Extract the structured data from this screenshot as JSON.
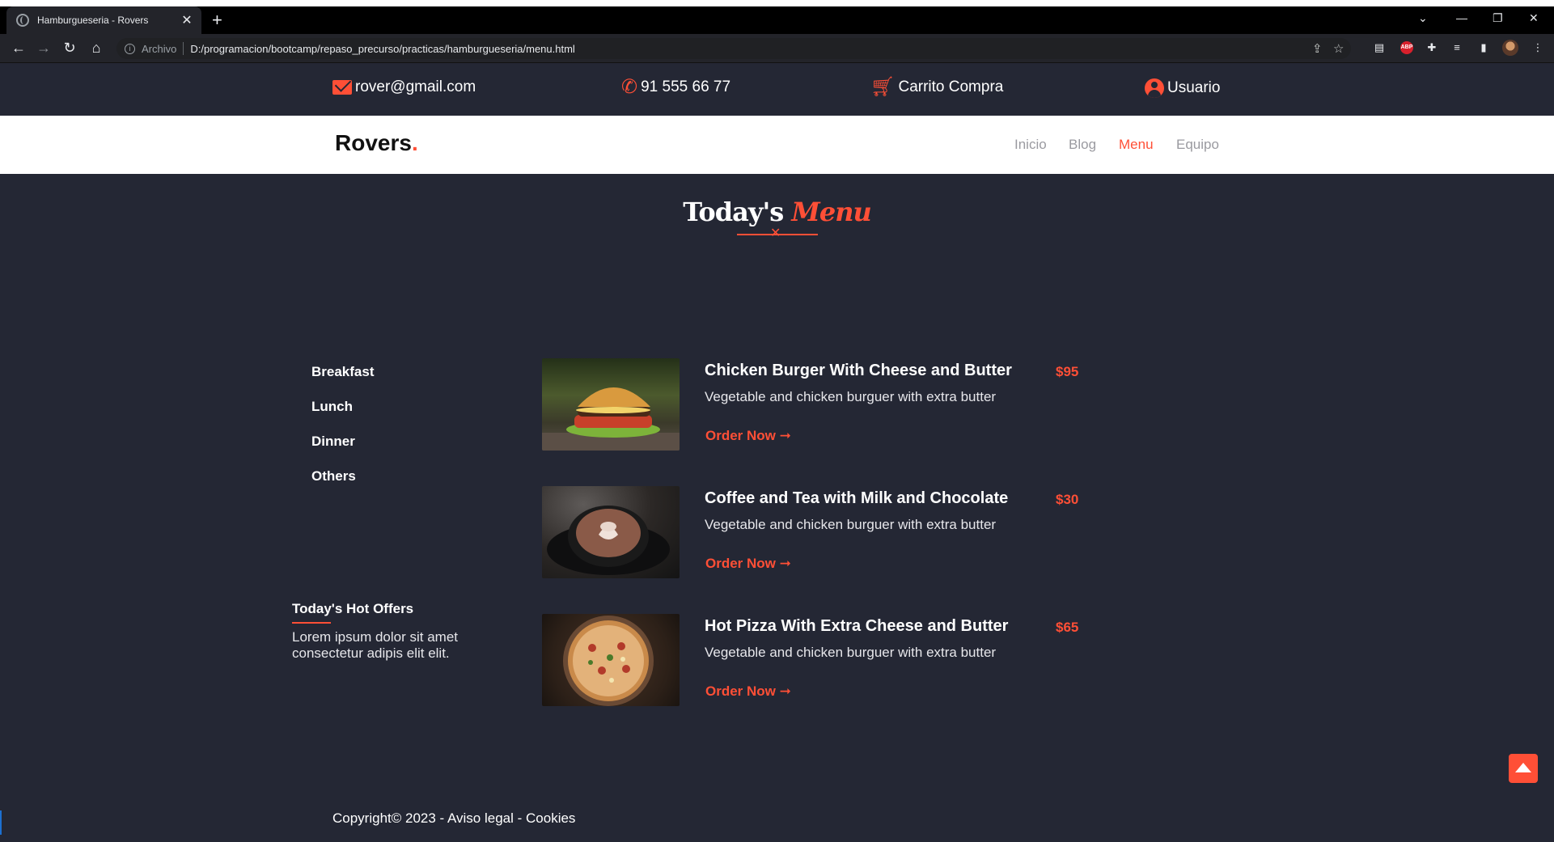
{
  "browser": {
    "tab_title": "Hamburgueseria - Rovers",
    "new_tab": "+",
    "scheme_label": "Archivo",
    "url": "D:/programacion/bootcamp/repaso_precurso/practicas/hamburgueseria/menu.html"
  },
  "topbar": {
    "email": "rover@gmail.com",
    "phone": "91 555 66 77",
    "cart": "Carrito Compra",
    "user": "Usuario"
  },
  "brand": {
    "name": "Rovers",
    "dot": "."
  },
  "nav": {
    "items": [
      "Inicio",
      "Blog",
      "Menu",
      "Equipo"
    ],
    "active": "Menu"
  },
  "heading": {
    "part1": "Today's",
    "part2": "Menu"
  },
  "categories": [
    "Breakfast",
    "Lunch",
    "Dinner",
    "Others"
  ],
  "offers": {
    "title": "Today's Hot Offers",
    "text": "Lorem ipsum dolor sit amet consectetur adipis elit elit."
  },
  "menu_items": [
    {
      "name": "Chicken Burger With Cheese and Butter",
      "price": "$95",
      "description": "Vegetable and chicken burguer with extra butter",
      "cta": "Order Now"
    },
    {
      "name": "Coffee and Tea with Milk and Chocolate",
      "price": "$30",
      "description": "Vegetable and chicken burguer with extra butter",
      "cta": "Order Now"
    },
    {
      "name": "Hot Pizza With Extra Cheese and Butter",
      "price": "$65",
      "description": "Vegetable and chicken burguer with extra butter",
      "cta": "Order Now"
    }
  ],
  "footer": {
    "text": "Copyright© 2023 - Aviso legal - Cookies"
  },
  "colors": {
    "accent": "#ff4f36",
    "background": "#242734",
    "nav_bg": "#ffffff"
  },
  "icons": [
    "envelope-icon",
    "phone-icon",
    "cart-icon",
    "user-circle-icon",
    "arrow-right-icon",
    "chevron-up-icon"
  ]
}
